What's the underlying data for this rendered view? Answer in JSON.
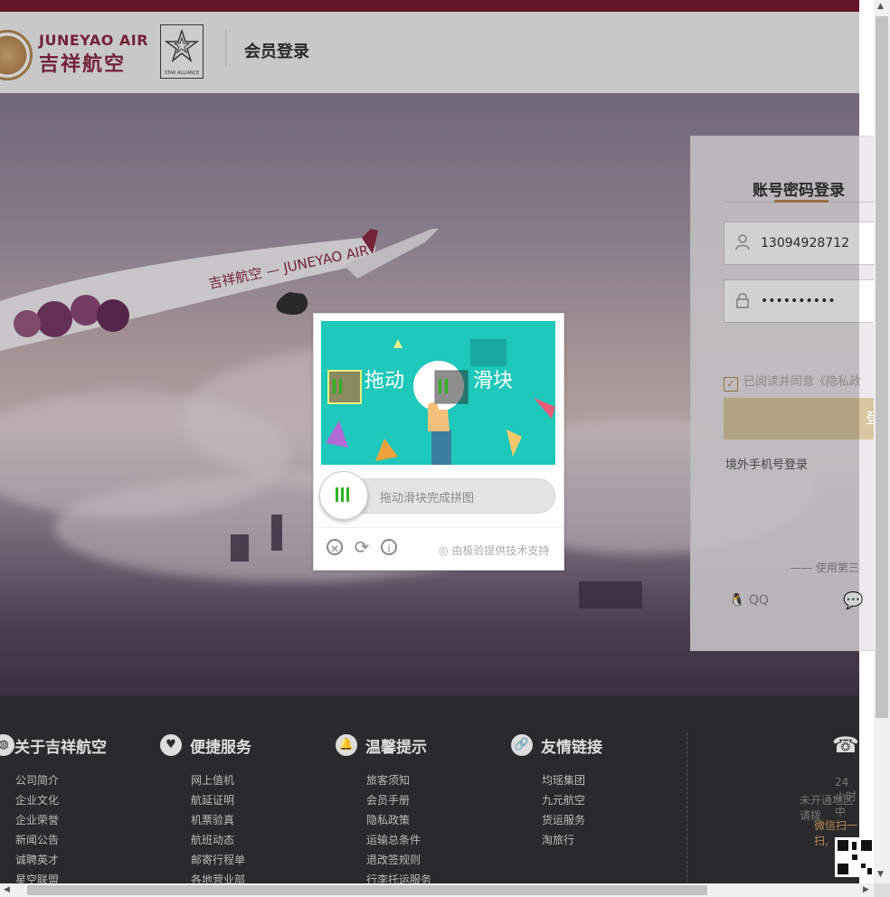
{
  "header": {
    "logo_en": "JUNEYAO AIR",
    "logo_cn": "吉祥航空",
    "alliance_text": "STAR ALLIANCE",
    "title": "会员登录"
  },
  "login": {
    "tab": "账号密码登录",
    "username": "13094928712",
    "password": "••••••••••",
    "agree_text": "已阅读并同意《隐私政",
    "login_button": "登",
    "overseas_link": "境外手机号登录",
    "third_party": "—— 使用第三",
    "qq": "QQ"
  },
  "captcha": {
    "image_text_left": "拖动",
    "image_text_right": "滑块",
    "slider_hint": "拖动滑块完成拼图",
    "brand": "由极验提供技术支持"
  },
  "footer": {
    "columns": [
      {
        "title": "关于吉祥航空",
        "icon": "globe-icon",
        "links": [
          "公司简介",
          "企业文化",
          "企业荣誉",
          "新闻公告",
          "诚聘英才",
          "星空联盟"
        ]
      },
      {
        "title": "便捷服务",
        "icon": "heart-icon",
        "links": [
          "网上值机",
          "航延证明",
          "机票验真",
          "航班动态",
          "邮寄行程单",
          "各地营业部"
        ]
      },
      {
        "title": "温馨提示",
        "icon": "bell-icon",
        "links": [
          "旅客须知",
          "会员手册",
          "隐私政策",
          "运输总条件",
          "退改签规则",
          "行李托运服务"
        ]
      },
      {
        "title": "友情链接",
        "icon": "link-icon",
        "links": [
          "均瑶集团",
          "九元航空",
          "货运服务",
          "淘旅行"
        ]
      }
    ],
    "hotline_1": "24小时中",
    "hotline_2": "未开通地区请拨",
    "wechat_scan": "微信扫一扫,"
  },
  "colors": {
    "brand": "#8d2a45",
    "gold": "#b98a52",
    "teal": "#1ec8bb",
    "green": "#2db51f"
  }
}
